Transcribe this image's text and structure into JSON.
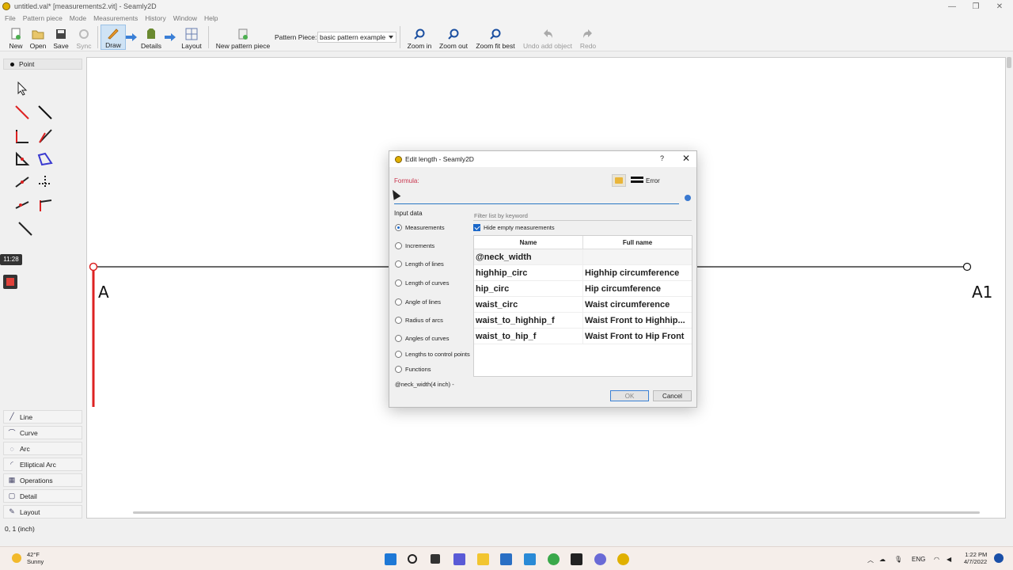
{
  "window": {
    "title": "untitled.val* [measurements2.vit] - Seamly2D",
    "minimize": "—",
    "maximize": "❐",
    "close": "✕"
  },
  "menu": [
    "File",
    "Pattern piece",
    "Mode",
    "Measurements",
    "History",
    "Window",
    "Help"
  ],
  "toolbar": {
    "new": "New",
    "open": "Open",
    "save": "Save",
    "sync": "Sync",
    "draw": "Draw",
    "details": "Details",
    "layout": "Layout",
    "new_pattern_piece": "New pattern piece",
    "pattern_piece_label": "Pattern Piece:",
    "pattern_piece_value": "basic pattern example",
    "zoom_in": "Zoom in",
    "zoom_out": "Zoom out",
    "zoom_fit": "Zoom fit best",
    "undo": "Undo add object",
    "redo": "Redo"
  },
  "left_panel": {
    "header": "Point",
    "time_badge": "11:28",
    "categories": [
      "Line",
      "Curve",
      "Arc",
      "Elliptical Arc",
      "Operations",
      "Detail",
      "Layout"
    ]
  },
  "canvas": {
    "point_a": "A",
    "point_a1": "A1"
  },
  "status": "0, 1 (inch)",
  "dialog": {
    "title": "Edit length - Seamly2D",
    "help": "?",
    "close": "✕",
    "formula_label": "Formula:",
    "error_label": "Error",
    "formula_value": "",
    "input_data_label": "Input data",
    "radios": [
      {
        "label": "Measurements",
        "checked": true
      },
      {
        "label": "Increments",
        "checked": false
      },
      {
        "label": "Length of lines",
        "checked": false
      },
      {
        "label": "Length of curves",
        "checked": false
      },
      {
        "label": "Angle of lines",
        "checked": false
      },
      {
        "label": "Radius of arcs",
        "checked": false
      },
      {
        "label": "Angles of curves",
        "checked": false
      },
      {
        "label": "Lengths to control points",
        "checked": false
      },
      {
        "label": "Functions",
        "checked": false
      }
    ],
    "filter_placeholder": "Filter list by keyword",
    "hide_empty_label": "Hide empty measurements",
    "table": {
      "headers": [
        "Name",
        "Full name"
      ],
      "rows": [
        [
          "@neck_width",
          ""
        ],
        [
          "highhip_circ",
          "Highhip circumference"
        ],
        [
          "hip_circ",
          "Hip circumference"
        ],
        [
          "waist_circ",
          "Waist circumference"
        ],
        [
          "waist_to_highhip_f",
          "Waist Front to Highhip..."
        ],
        [
          "waist_to_hip_f",
          "Waist Front to Hip Front"
        ]
      ]
    },
    "description": "@neck_width(4 inch) -",
    "ok": "OK",
    "cancel": "Cancel"
  },
  "taskbar": {
    "weather_temp": "42°F",
    "weather_desc": "Sunny",
    "lang": "ENG",
    "time": "1:22 PM",
    "date": "4/7/2022"
  }
}
